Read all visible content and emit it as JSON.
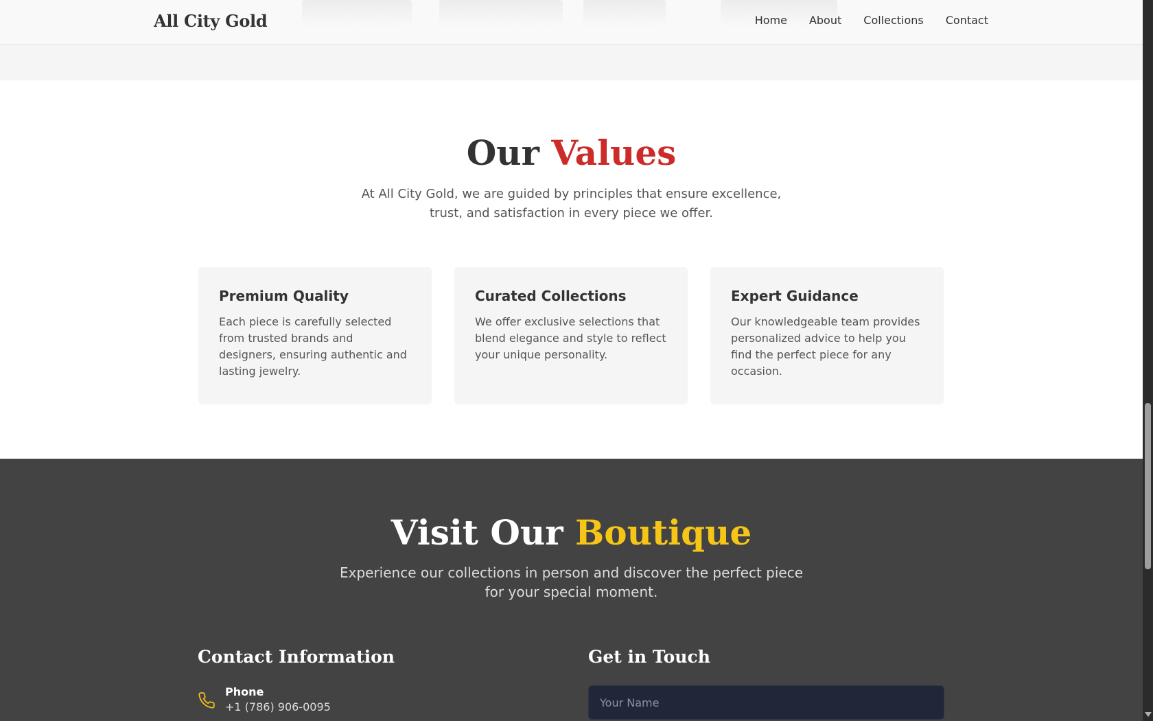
{
  "header": {
    "logo": "All City Gold",
    "nav": [
      "Home",
      "About",
      "Collections",
      "Contact"
    ]
  },
  "values": {
    "title_plain": "Our",
    "title_accent": "Values",
    "subtitle": "At All City Gold, we are guided by principles that ensure excellence, trust, and satisfaction in every piece we offer.",
    "cards": [
      {
        "title": "Premium Quality",
        "text": "Each piece is carefully selected from trusted brands and designers, ensuring authentic and lasting jewelry."
      },
      {
        "title": "Curated Collections",
        "text": "We offer exclusive selections that blend elegance and style to reflect your unique personality."
      },
      {
        "title": "Expert Guidance",
        "text": "Our knowledgeable team provides personalized advice to help you find the perfect piece for any occasion."
      }
    ]
  },
  "boutique": {
    "title_plain": "Visit Our",
    "title_accent": "Boutique",
    "subtitle": "Experience our collections in person and discover the perfect piece for your special moment.",
    "contact_heading": "Contact Information",
    "phone_label": "Phone",
    "phone_value": "+1 (786) 906-0095",
    "form_heading": "Get in Touch",
    "name_placeholder": "Your Name"
  },
  "colors": {
    "red_accent": "#cc2b2b",
    "gold_accent": "#f5c518",
    "dark_bg": "#434343",
    "input_bg": "#1f2739"
  },
  "icons": [
    "phone-icon"
  ]
}
